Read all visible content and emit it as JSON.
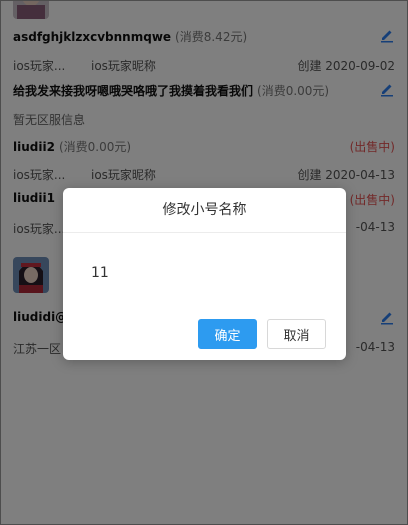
{
  "accounts": [
    {
      "name": "asdfghjklzxcvbnnmqwe",
      "cost": "(消费8.42元)",
      "platform": "ios玩家...",
      "nickname": "ios玩家昵称",
      "created": "创建 2020-09-02"
    },
    {
      "name": "给我发来接我呀嗯哦哭咯哦了我摸着我看我们",
      "cost": "(消费0.00元)",
      "note": "暂无区服信息"
    },
    {
      "name": "liudii2",
      "cost": "(消费0.00元)",
      "status": "(出售中)",
      "platform": "ios玩家...",
      "nickname": "ios玩家昵称",
      "created": "创建 2020-04-13"
    },
    {
      "name": "liudii1",
      "status": "(出售中)",
      "platform": "ios玩家...",
      "created": "-04-13"
    },
    {
      "name": "liudidi@",
      "platform": "江苏一区",
      "created": "-04-13"
    }
  ],
  "dialog": {
    "title": "修改小号名称",
    "input_value": "11",
    "confirm_label": "确定",
    "cancel_label": "取消"
  },
  "colors": {
    "accent": "#2d9bf0",
    "status": "#e55353",
    "edit_icon": "#2d7ff0"
  }
}
